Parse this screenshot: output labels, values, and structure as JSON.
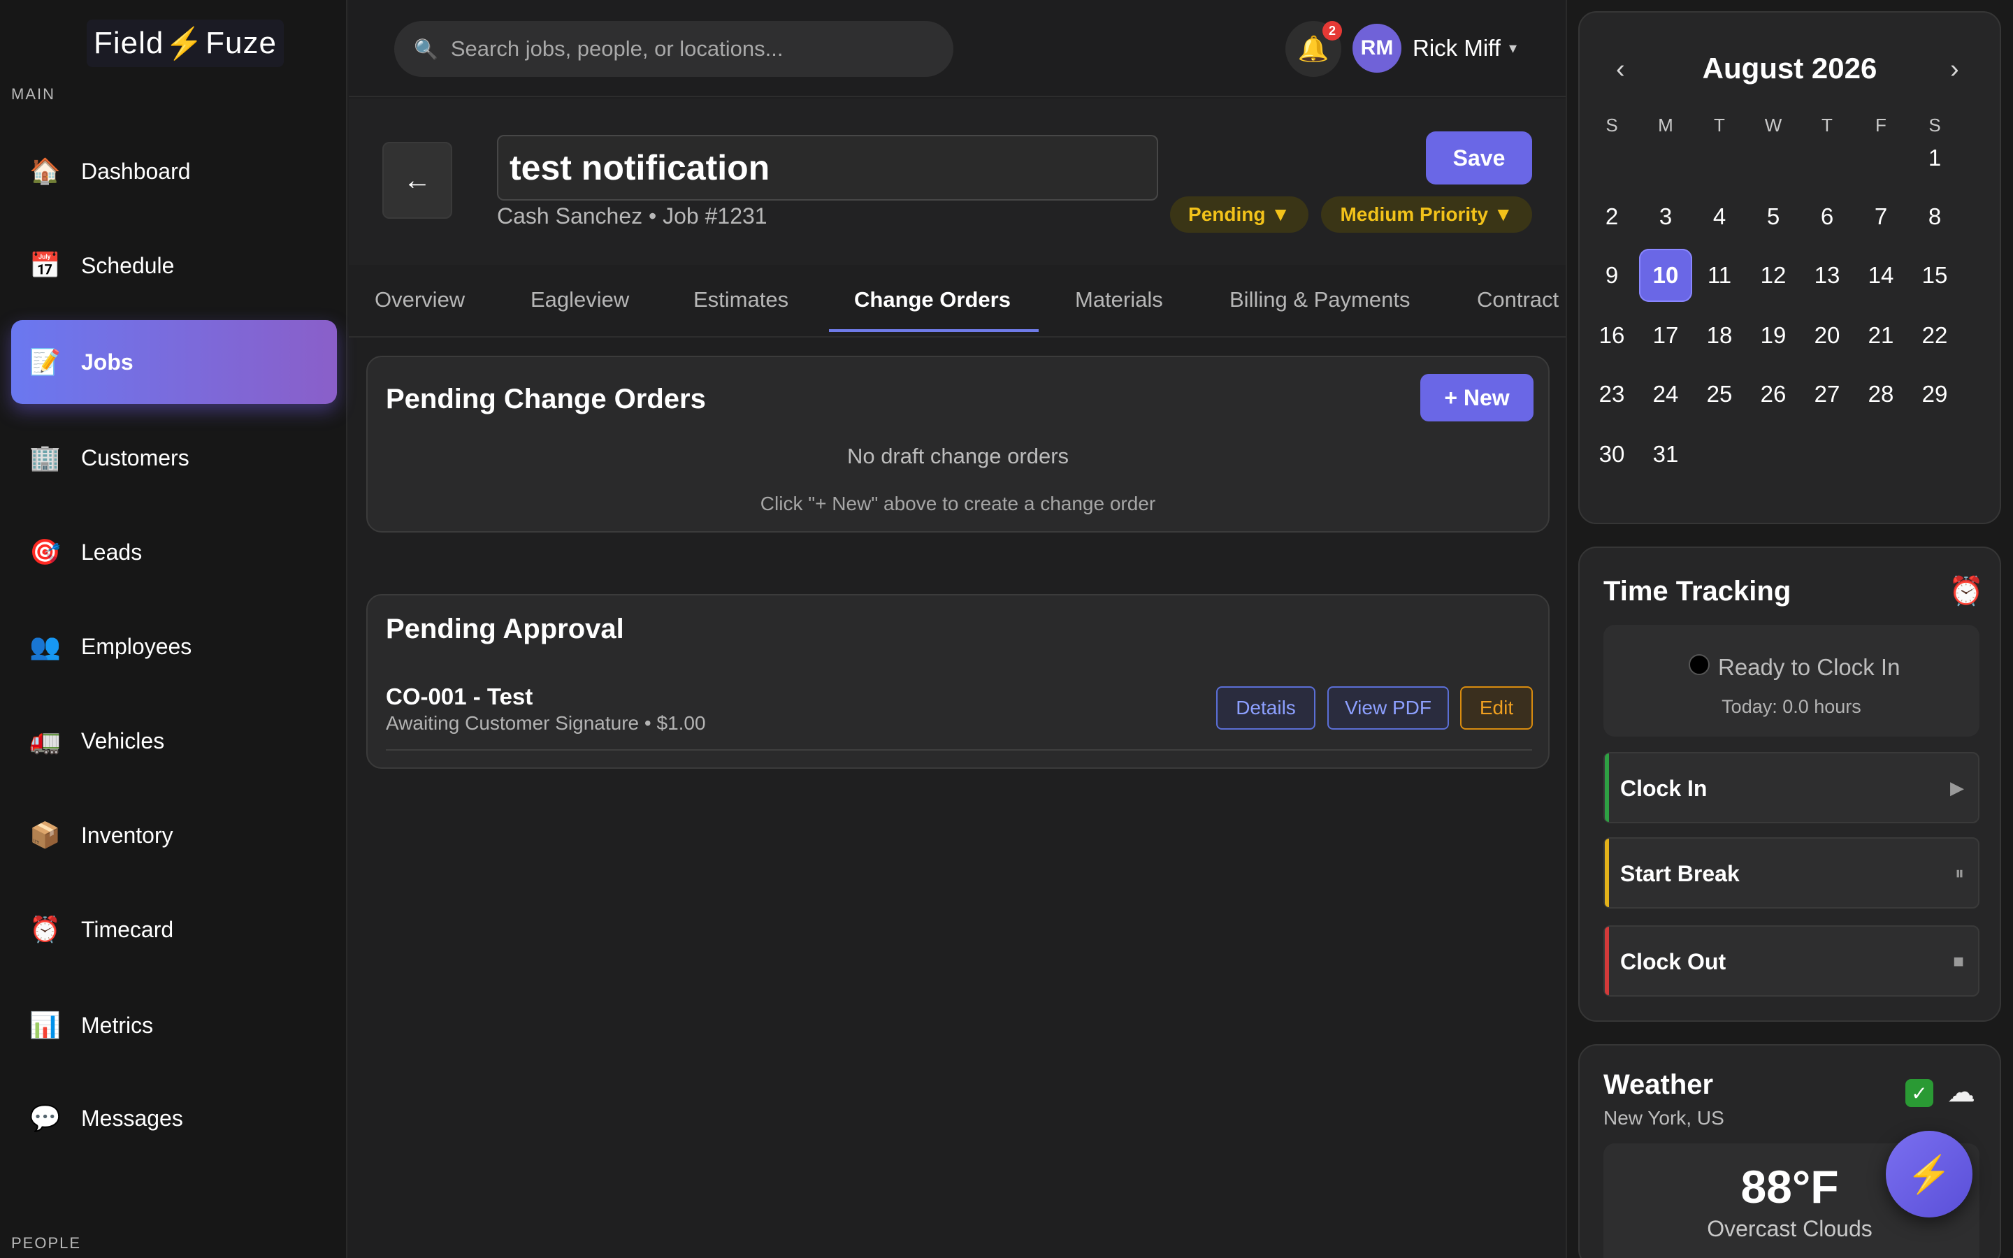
{
  "brand": {
    "name_left": "Field",
    "bolt": "⚡",
    "name_right": "Fuze"
  },
  "sidebar": {
    "section_main": "MAIN",
    "section_people": "PEOPLE",
    "items": [
      {
        "icon": "🏠",
        "icon_name": "house-icon",
        "label": "Dashboard"
      },
      {
        "icon": "📅",
        "icon_name": "calendar-icon",
        "label": "Schedule"
      },
      {
        "icon": "📝",
        "icon_name": "memo-icon",
        "label": "Jobs",
        "active": true
      },
      {
        "icon": "🏢",
        "icon_name": "building-icon",
        "label": "Customers"
      },
      {
        "icon": "🎯",
        "icon_name": "target-icon",
        "label": "Leads"
      },
      {
        "icon": "👥",
        "icon_name": "people-icon",
        "label": "Employees"
      },
      {
        "icon": "🚛",
        "icon_name": "truck-icon",
        "label": "Vehicles"
      },
      {
        "icon": "📦",
        "icon_name": "package-icon",
        "label": "Inventory"
      },
      {
        "icon": "⏰",
        "icon_name": "alarm-clock-icon",
        "label": "Timecard"
      },
      {
        "icon": "📊",
        "icon_name": "bar-chart-icon",
        "label": "Metrics"
      },
      {
        "icon": "💬",
        "icon_name": "speech-bubble-icon",
        "label": "Messages"
      }
    ]
  },
  "topbar": {
    "search_placeholder": "Search jobs, people, or locations...",
    "search_icon": "🔍",
    "bell_icon": "🔔",
    "notification_count": "2",
    "user_initials": "RM",
    "user_name": "Rick Miff",
    "user_caret": "▾"
  },
  "job": {
    "back_arrow": "←",
    "title": "test notification",
    "customer": "Cash Sanchez",
    "separator": "•",
    "job_number": "Job #1231",
    "save_label": "Save",
    "status": "Pending ▼",
    "priority": "Medium Priority ▼"
  },
  "tabs": [
    {
      "label": "Overview"
    },
    {
      "label": "Eagleview"
    },
    {
      "label": "Estimates"
    },
    {
      "label": "Change Orders",
      "active": true
    },
    {
      "label": "Materials"
    },
    {
      "label": "Billing & Payments"
    },
    {
      "label": "Contract"
    }
  ],
  "pending_change_orders": {
    "title": "Pending Change Orders",
    "new_label": "+ New",
    "empty_title": "No draft change orders",
    "empty_hint": "Click \"+ New\" above to create a change order"
  },
  "pending_approval": {
    "title": "Pending Approval",
    "items": [
      {
        "name": "CO-001 - Test",
        "status": "Awaiting Customer Signature",
        "amount": "$1.00",
        "details_label": "Details",
        "pdf_label": "View PDF",
        "edit_label": "Edit"
      }
    ]
  },
  "calendar": {
    "prev": "‹",
    "next": "›",
    "month_title": "August 2026",
    "weekdays": [
      "S",
      "M",
      "T",
      "W",
      "T",
      "F",
      "S"
    ],
    "first_weekday_index": 6,
    "days_in_month": 31,
    "today": 10
  },
  "time_tracking": {
    "title": "Time Tracking",
    "alarm_icon": "⏰",
    "status": "Ready to Clock In",
    "today": "Today: 0.0 hours",
    "actions": [
      {
        "label": "Clock In",
        "icon": "▶",
        "icon_name": "play-icon",
        "color": "#2ea043"
      },
      {
        "label": "Start Break",
        "icon": "⏸",
        "icon_name": "pause-icon",
        "color": "#e3b21a"
      },
      {
        "label": "Clock Out",
        "icon": "■",
        "icon_name": "stop-icon",
        "color": "#d33a3a"
      }
    ]
  },
  "weather": {
    "title": "Weather",
    "location": "New York, US",
    "check_icon": "✓",
    "cloud_icon": "☁",
    "temperature": "88°F",
    "condition": "Overcast Clouds"
  },
  "fab_icon": "⚡",
  "colors": {
    "accent": "#6a67e6",
    "active_nav_gradient_start": "#6a78f0",
    "active_nav_gradient_end": "#8a5fc9",
    "pill_text": "#f2c21a",
    "edit_orange": "#f0a020",
    "notification_red": "#e53935"
  }
}
